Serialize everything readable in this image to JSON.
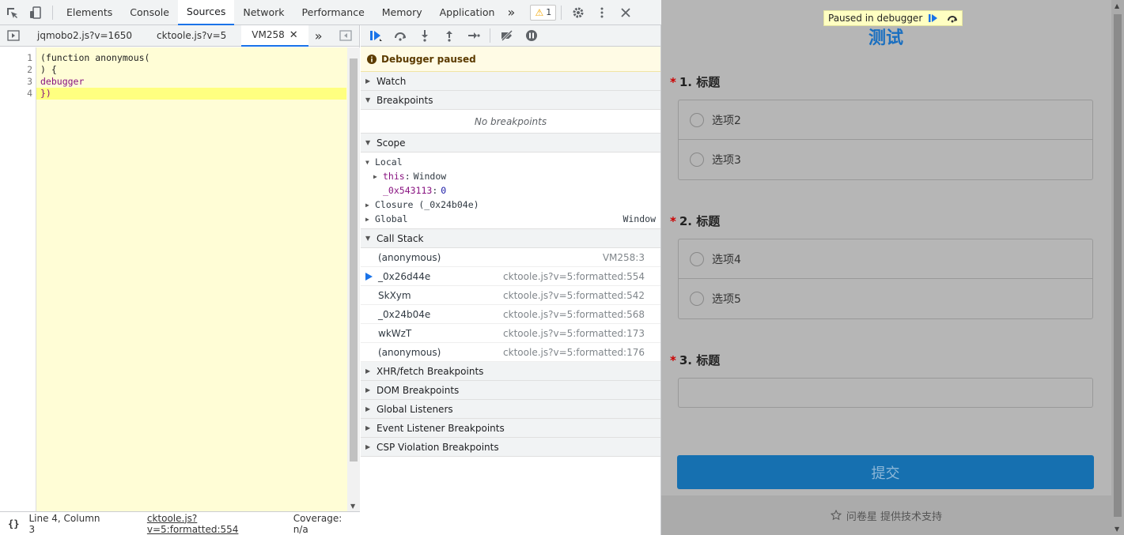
{
  "toolbar": {
    "tabs": [
      "Elements",
      "Console",
      "Sources",
      "Network",
      "Performance",
      "Memory",
      "Application"
    ],
    "active_tab": "Sources",
    "warning_count": "1"
  },
  "sources": {
    "file_tabs": [
      "jqmobo2.js?v=1650",
      "cktoole.js?v=5",
      "VM258"
    ],
    "active_file": "VM258",
    "code_lines": [
      {
        "num": "1",
        "text": "(function anonymous("
      },
      {
        "num": "2",
        "text": ") {"
      },
      {
        "num": "3",
        "text": "debugger"
      },
      {
        "num": "4",
        "text": "})"
      }
    ],
    "status": {
      "braces": "{}",
      "position": "Line 4, Column 3",
      "link": "cktoole.js?v=5:formatted:554",
      "coverage": "Coverage: n/a"
    }
  },
  "debugger": {
    "paused_message": "Debugger paused",
    "sections": {
      "watch": "Watch",
      "breakpoints": "Breakpoints",
      "no_breakpoints": "No breakpoints",
      "scope": "Scope",
      "call_stack": "Call Stack",
      "xhr": "XHR/fetch Breakpoints",
      "dom": "DOM Breakpoints",
      "global_listeners": "Global Listeners",
      "event_listeners": "Event Listener Breakpoints",
      "csp": "CSP Violation Breakpoints"
    },
    "scope": {
      "local": "Local",
      "this_key": "this",
      "this_val": "Window",
      "var_key": "_0x543113",
      "var_val": "0",
      "closure": "Closure (_0x24b04e)",
      "global": "Global",
      "global_val": "Window"
    },
    "call_stack": [
      {
        "name": "(anonymous)",
        "loc": "VM258:3",
        "current": false
      },
      {
        "name": "_0x26d44e",
        "loc": "cktoole.js?v=5:formatted:554",
        "current": true
      },
      {
        "name": "SkXym",
        "loc": "cktoole.js?v=5:formatted:542",
        "current": false
      },
      {
        "name": "_0x24b04e",
        "loc": "cktoole.js?v=5:formatted:568",
        "current": false
      },
      {
        "name": "wkWzT",
        "loc": "cktoole.js?v=5:formatted:173",
        "current": false
      },
      {
        "name": "(anonymous)",
        "loc": "cktoole.js?v=5:formatted:176",
        "current": false
      }
    ]
  },
  "page": {
    "overlay_text": "Paused in debugger",
    "title": "测试",
    "q1": {
      "num": "1.",
      "title": "标题",
      "options": [
        "选项2",
        "选项3"
      ]
    },
    "q2": {
      "num": "2.",
      "title": "标题",
      "options": [
        "选项4",
        "选项5"
      ]
    },
    "q3": {
      "num": "3.",
      "title": "标题"
    },
    "required_mark": "*",
    "submit": "提交",
    "footer": "问卷星 提供技术支持"
  },
  "colors": {
    "accent": "#1a73e8",
    "submit_bg": "#1670b0",
    "title_blue": "#1a6fc0",
    "editor_bg": "#fffdd6",
    "highlight_line": "#ffff80"
  }
}
